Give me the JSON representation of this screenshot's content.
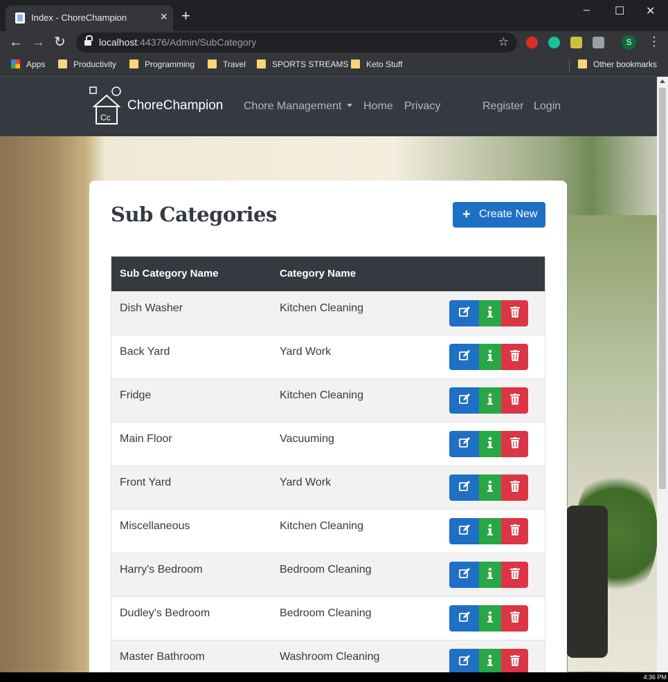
{
  "browser": {
    "tab_title": "Index - ChoreChampion",
    "tab_close": "×",
    "new_tab": "+",
    "window_controls": {
      "minimize": "–",
      "maximize": "☐",
      "close": "✕"
    },
    "nav": {
      "back": "←",
      "forward": "→",
      "reload": "↻"
    },
    "url_host": "localhost",
    "url_rest": ":44376/Admin/SubCategory",
    "star": "☆",
    "profile_initial": "S",
    "menu": "⋮",
    "bookmarks": [
      "Apps",
      "Productivity",
      "Programming",
      "Travel",
      "SPORTS STREAMS",
      "Keto Stuff"
    ],
    "other_bookmarks": "Other bookmarks"
  },
  "app": {
    "brand": "ChoreChampion",
    "nav_links": [
      "Chore Management",
      "Home",
      "Privacy"
    ],
    "auth_links": [
      "Register",
      "Login"
    ]
  },
  "page": {
    "title": "Sub Categories",
    "create_button": "Create New",
    "create_icon": "+",
    "columns": [
      "Sub Category Name",
      "Category Name"
    ],
    "rows": [
      {
        "sub": "Dish Washer",
        "cat": "Kitchen Cleaning"
      },
      {
        "sub": "Back Yard",
        "cat": "Yard Work"
      },
      {
        "sub": "Fridge",
        "cat": "Kitchen Cleaning"
      },
      {
        "sub": "Main Floor",
        "cat": "Vacuuming"
      },
      {
        "sub": "Front Yard",
        "cat": "Yard Work"
      },
      {
        "sub": "Miscellaneous",
        "cat": "Kitchen Cleaning"
      },
      {
        "sub": "Harry's Bedroom",
        "cat": "Bedroom Cleaning"
      },
      {
        "sub": "Dudley's Bedroom",
        "cat": "Bedroom Cleaning"
      },
      {
        "sub": "Master Bathroom",
        "cat": "Washroom Cleaning"
      }
    ],
    "row_actions": [
      "edit-icon",
      "info-icon",
      "trash-icon"
    ]
  },
  "colors": {
    "navbar": "#343a40",
    "primary": "#1f6fc5",
    "success": "#28a745",
    "danger": "#dc3545"
  },
  "taskbar": {
    "clock": "4:36 PM"
  }
}
